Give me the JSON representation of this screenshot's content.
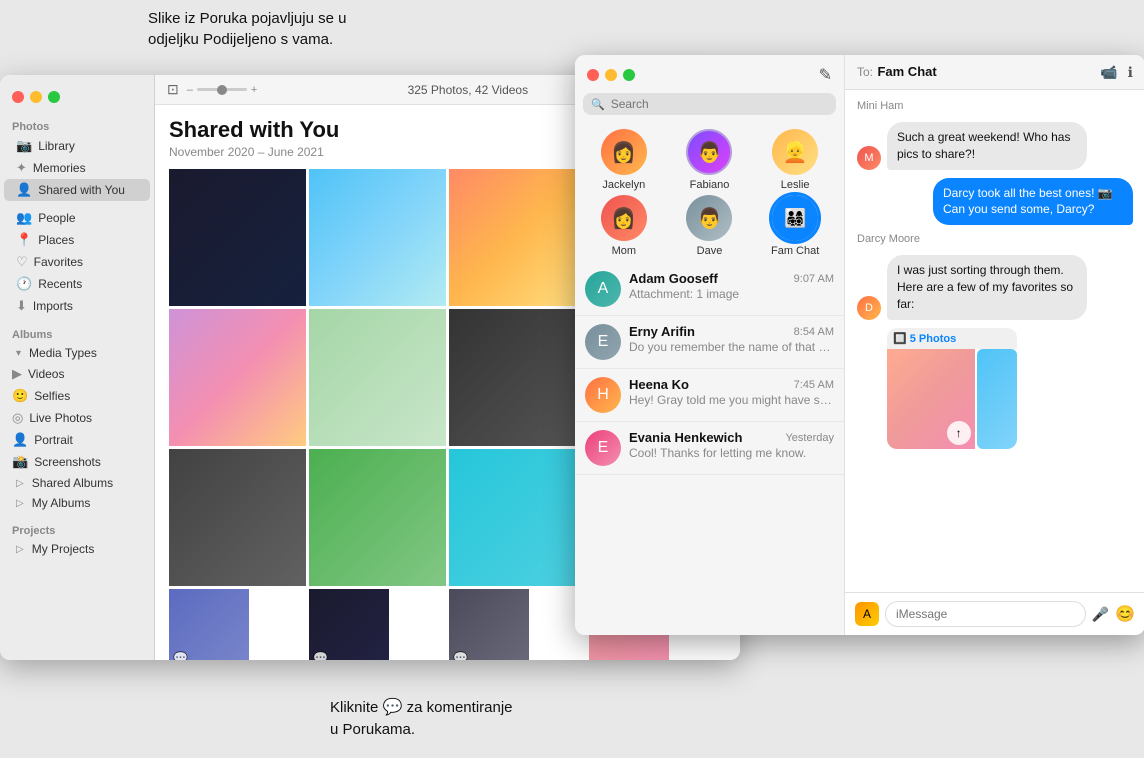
{
  "annotation_top": "Slike iz Poruka pojavljuju se u\nodjeljku Podijeljeno s vama.",
  "annotation_bottom": "Kliknite   za komentiranje\nu Porukama.",
  "photos_app": {
    "toolbar": {
      "count": "325 Photos, 42 Videos"
    },
    "content": {
      "title": "Shared with You",
      "subtitle": "November 2020 – June 2021"
    },
    "sidebar": {
      "sections": [
        {
          "label": "Photos",
          "items": [
            {
              "id": "library",
              "label": "Library",
              "icon": "📷"
            },
            {
              "id": "memories",
              "label": "Memories",
              "icon": "✦"
            },
            {
              "id": "shared-with-you",
              "label": "Shared with You",
              "icon": "👤",
              "active": true
            }
          ]
        },
        {
          "label": "",
          "items": [
            {
              "id": "people",
              "label": "People",
              "icon": "👤"
            },
            {
              "id": "places",
              "label": "Places",
              "icon": "📍"
            },
            {
              "id": "favorites",
              "label": "Favorites",
              "icon": "♡"
            },
            {
              "id": "recents",
              "label": "Recents",
              "icon": "🕐"
            },
            {
              "id": "imports",
              "label": "Imports",
              "icon": "⬇"
            }
          ]
        },
        {
          "label": "Albums",
          "items": [
            {
              "id": "media-types",
              "label": "Media Types",
              "icon": "▾",
              "group": true
            },
            {
              "id": "videos",
              "label": "Videos",
              "icon": "▶",
              "sub": true
            },
            {
              "id": "selfies",
              "label": "Selfies",
              "icon": "🙂",
              "sub": true
            },
            {
              "id": "live-photos",
              "label": "Live Photos",
              "icon": "◎",
              "sub": true
            },
            {
              "id": "portrait",
              "label": "Portrait",
              "icon": "👤",
              "sub": true
            },
            {
              "id": "screenshots",
              "label": "Screenshots",
              "icon": "📸",
              "sub": true
            },
            {
              "id": "shared-albums",
              "label": "Shared Albums",
              "icon": "▷",
              "group": true
            },
            {
              "id": "my-albums",
              "label": "My Albums",
              "icon": "▷",
              "group": true
            }
          ]
        },
        {
          "label": "Projects",
          "items": [
            {
              "id": "my-projects",
              "label": "My Projects",
              "icon": "▷",
              "group": true
            }
          ]
        }
      ]
    }
  },
  "messages_app": {
    "header": {
      "to_label": "To:",
      "chat_name": "Fam Chat",
      "video_icon": "📹",
      "info_icon": "ℹ"
    },
    "search_placeholder": "Search",
    "pinned": [
      {
        "id": "jackelyn",
        "label": "Jackelyn",
        "avatar_color": "av-jackelyn"
      },
      {
        "id": "fabiano",
        "label": "Fabiano",
        "avatar_color": "av-fabiano"
      },
      {
        "id": "leslie",
        "label": "Leslie",
        "avatar_color": "av-leslie"
      },
      {
        "id": "mom",
        "label": "Mom",
        "avatar_color": "av-mom"
      },
      {
        "id": "dave",
        "label": "Dave",
        "avatar_color": "av-dave"
      },
      {
        "id": "famchat",
        "label": "Fam Chat",
        "avatar_color": "av-famchat",
        "active": true
      }
    ],
    "conversations": [
      {
        "id": "adam",
        "name": "Adam Gooseff",
        "time": "9:07 AM",
        "preview": "Attachment: 1 image",
        "avatar_color": "av-adam"
      },
      {
        "id": "erny",
        "name": "Erny Arifin",
        "time": "8:54 AM",
        "preview": "Do you remember the name of that guy from brunch?",
        "avatar_color": "av-erny"
      },
      {
        "id": "heena",
        "name": "Heena Ko",
        "time": "7:45 AM",
        "preview": "Hey! Gray told me you might have some good recommendations for our...",
        "avatar_color": "av-heena"
      },
      {
        "id": "evania",
        "name": "Evania Henkewich",
        "time": "Yesterday",
        "preview": "Cool! Thanks for letting me know.",
        "avatar_color": "av-evania"
      }
    ],
    "chat": {
      "messages": [
        {
          "id": "msg1",
          "type": "received",
          "sender": "Mini Ham",
          "text": "Such a great weekend! Who has pics to share?!",
          "avatar": "av-mom"
        },
        {
          "id": "msg2",
          "type": "sent",
          "text": "Darcy took all the best ones! 📷 Can you send some, Darcy?"
        },
        {
          "id": "msg3",
          "type": "received_group",
          "sender": "Darcy Moore",
          "text": "I was just sorting through them. Here are a few of my favorites so far:",
          "photos_label": "🔲 5 Photos",
          "avatar": "av-heena"
        }
      ],
      "input_placeholder": "iMessage"
    }
  }
}
